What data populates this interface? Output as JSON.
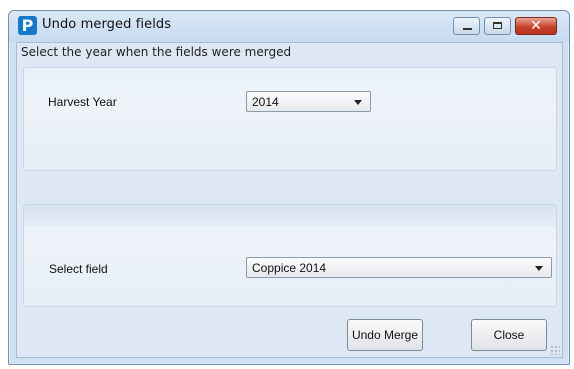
{
  "window": {
    "title": "Undo merged fields",
    "app_icon_letter": "P",
    "controls": {
      "minimize": "minimize-icon",
      "maximize": "maximize-icon",
      "close": "close-icon"
    }
  },
  "instructions": "Select the year when the fields were merged",
  "harvest_year": {
    "label": "Harvest Year",
    "value": "2014"
  },
  "field_select": {
    "label": "Select field",
    "value": "Coppice 2014"
  },
  "buttons": {
    "undo_merge": "Undo Merge",
    "close": "Close"
  },
  "colors": {
    "title_bar": "#cfe0f1",
    "close_button": "#c7412d",
    "app_icon": "#1479c8"
  }
}
